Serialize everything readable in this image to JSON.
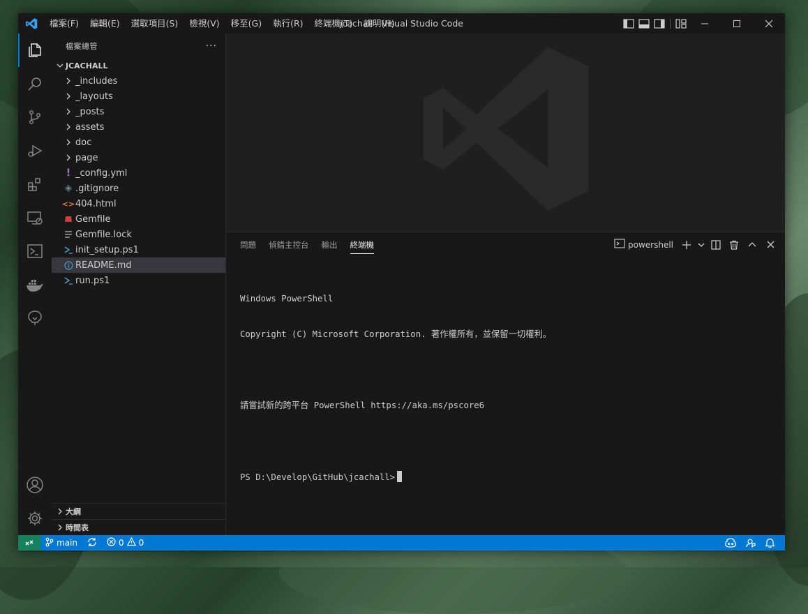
{
  "colors": {
    "accent": "#0078d4",
    "remote": "#16825d",
    "titlebar": "#181818",
    "editor_bg": "#1f1f1f"
  },
  "titlebar": {
    "title": "jcachall - Visual Studio Code",
    "menu": [
      "檔案(F)",
      "編輯(E)",
      "選取項目(S)",
      "檢視(V)",
      "移至(G)",
      "執行(R)",
      "終端機(T)",
      "說明(H)"
    ],
    "layout_icons": [
      "toggle-primary-sidebar-icon",
      "toggle-panel-icon",
      "toggle-secondary-sidebar-icon",
      "customize-layout-icon"
    ],
    "window_controls": [
      "minimize-icon",
      "maximize-icon",
      "close-icon"
    ]
  },
  "activitybar": {
    "top": [
      "explorer-icon",
      "search-icon",
      "source-control-icon",
      "run-debug-icon",
      "extensions-icon",
      "remote-explorer-icon",
      "powershell-icon",
      "docker-icon",
      "gitlens-icon"
    ],
    "bottom": [
      "account-icon",
      "manage-gear-icon"
    ]
  },
  "sidebar": {
    "header": "檔案總管",
    "more": "···",
    "folder": "JCACHALL",
    "items": [
      {
        "label": "_includes",
        "type": "folder"
      },
      {
        "label": "_layouts",
        "type": "folder"
      },
      {
        "label": "_posts",
        "type": "folder"
      },
      {
        "label": "assets",
        "type": "folder"
      },
      {
        "label": "doc",
        "type": "folder"
      },
      {
        "label": "page",
        "type": "folder"
      },
      {
        "label": "_config.yml",
        "type": "yaml"
      },
      {
        "label": ".gitignore",
        "type": "git"
      },
      {
        "label": "404.html",
        "type": "html"
      },
      {
        "label": "Gemfile",
        "type": "ruby"
      },
      {
        "label": "Gemfile.lock",
        "type": "lock"
      },
      {
        "label": "init_setup.ps1",
        "type": "ps1"
      },
      {
        "label": "README.md",
        "type": "info",
        "selected": true
      },
      {
        "label": "run.ps1",
        "type": "ps1"
      }
    ],
    "sections": [
      "大綱",
      "時間表"
    ]
  },
  "panel": {
    "tabs": [
      "問題",
      "偵錯主控台",
      "輸出",
      "終端機"
    ],
    "active_tab": "終端機",
    "terminal_name": "powershell",
    "terminal_lines": [
      "Windows PowerShell",
      "Copyright (C) Microsoft Corporation. 著作權所有，並保留一切權利。",
      "",
      "請嘗試新的跨平台 PowerShell https://aka.ms/pscore6",
      ""
    ],
    "prompt": "PS D:\\Develop\\GitHub\\jcachall>"
  },
  "statusbar": {
    "branch": "main",
    "errors": "0",
    "warnings": "0"
  }
}
